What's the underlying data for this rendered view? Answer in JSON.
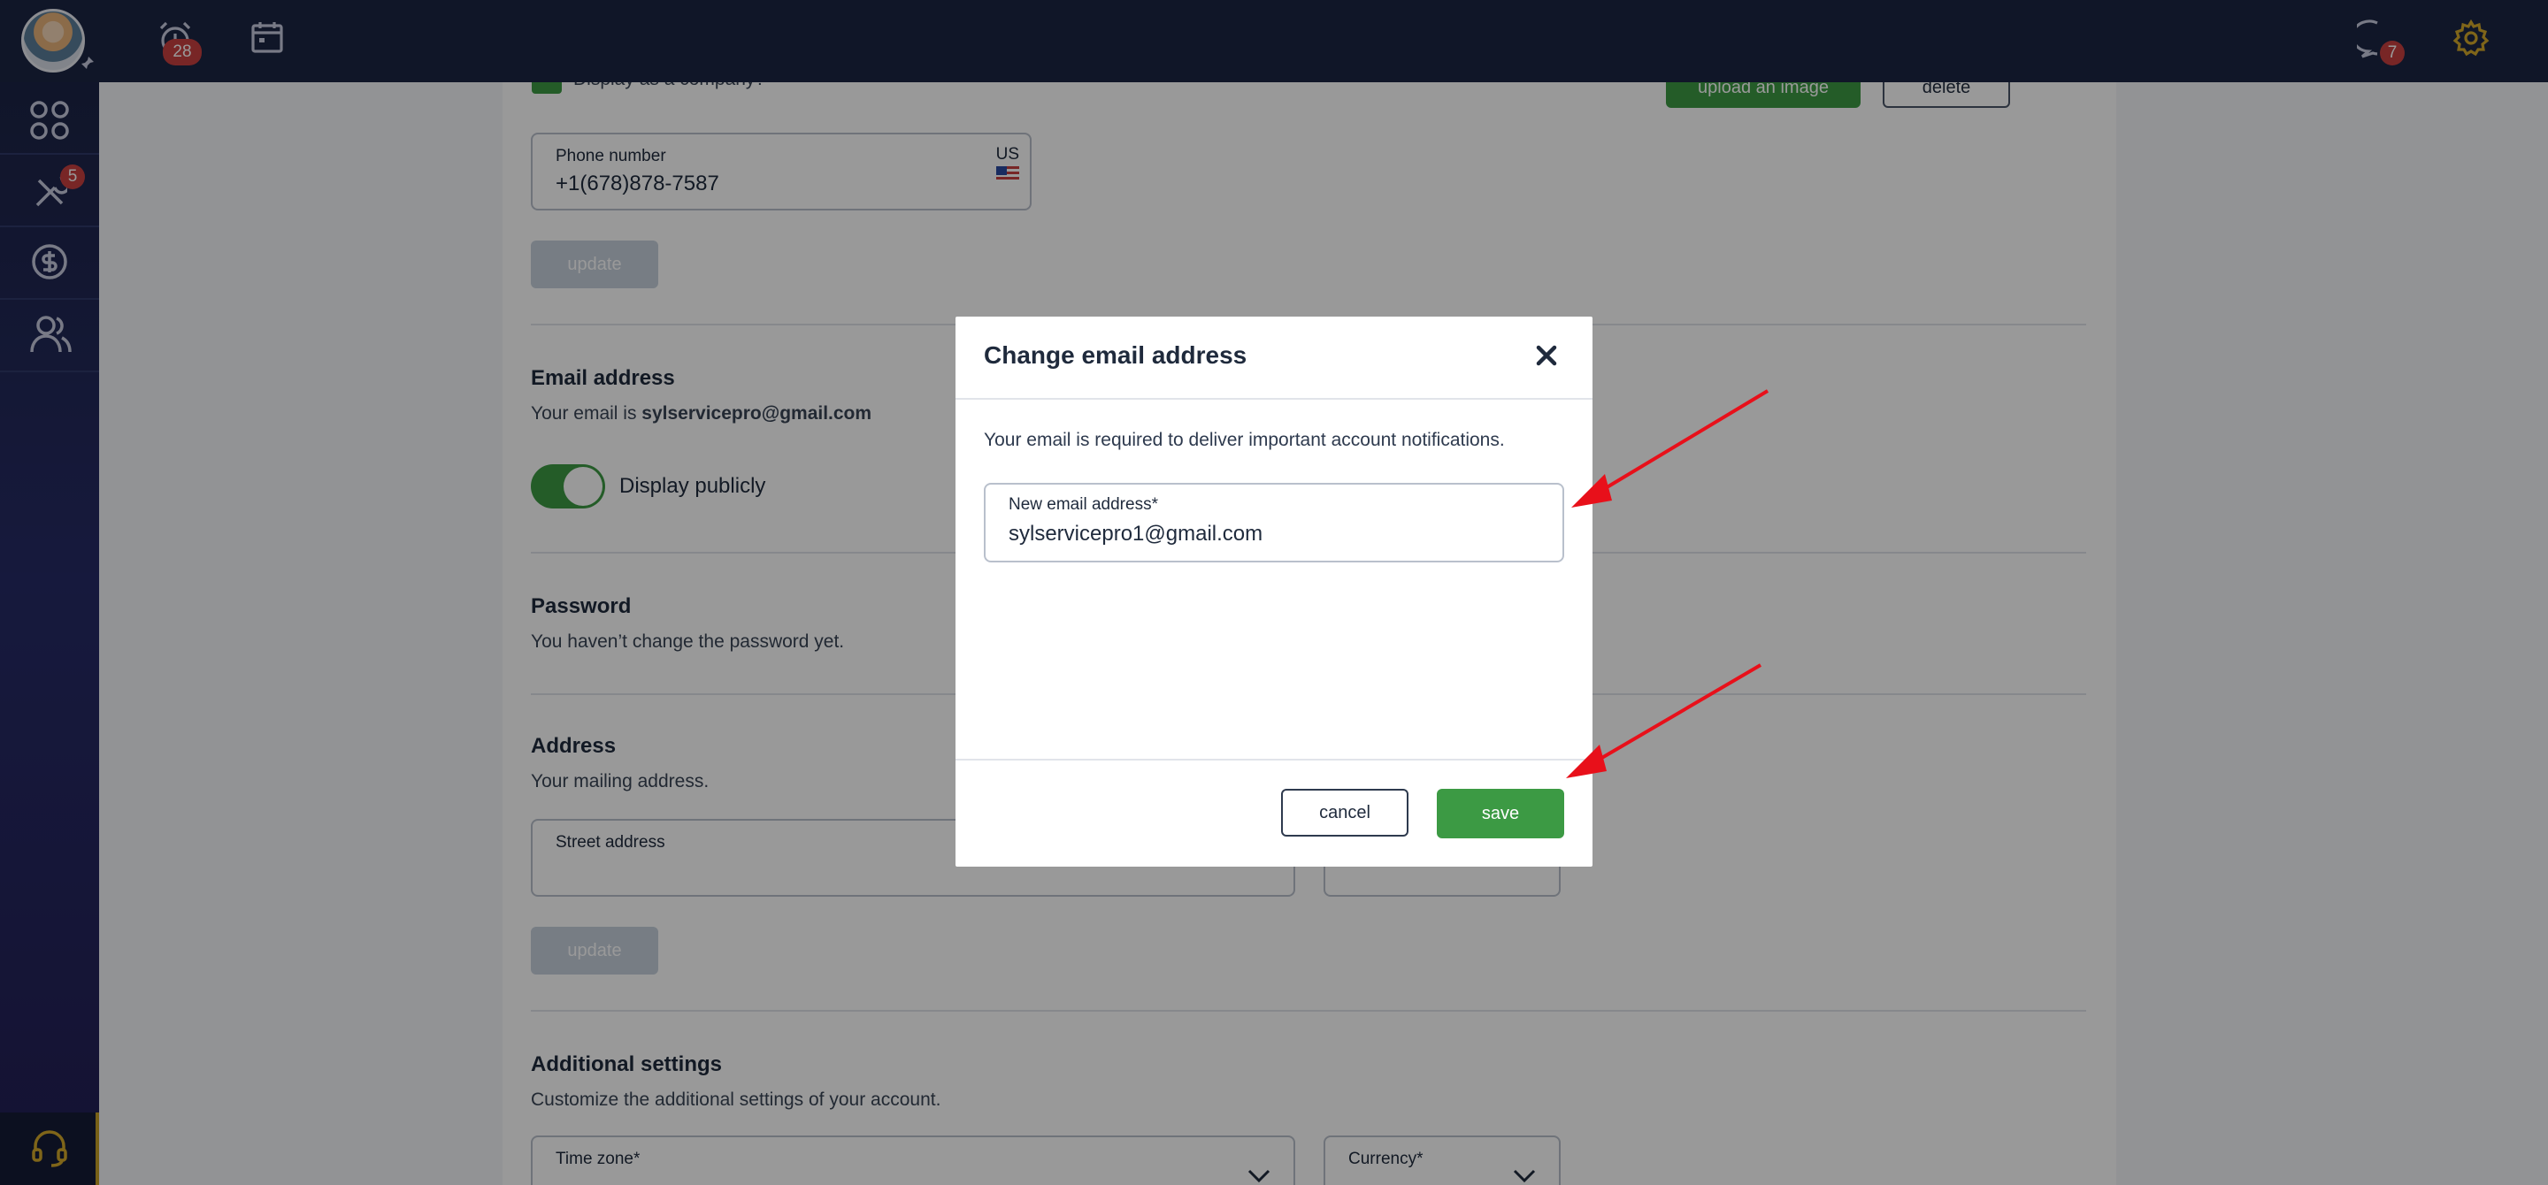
{
  "header": {
    "alarm_badge": "28",
    "messages_badge": "7"
  },
  "sidebar": {
    "tools_badge": "5"
  },
  "profile": {
    "display_company_label": "Display as a company?",
    "upload_image_label": "upload an image",
    "delete_label": "delete",
    "phone": {
      "label": "Phone number",
      "value": "+1(678)878-7587",
      "country": "US"
    },
    "update_label": "update",
    "email": {
      "title": "Email address",
      "text_prefix": "Your email is ",
      "current": "sylservicepro@gmail.com",
      "display_publicly_label": "Display publicly"
    },
    "password": {
      "title": "Password",
      "text": "You haven’t change the password yet."
    },
    "address": {
      "title": "Address",
      "text": "Your mailing address.",
      "street_label": "Street address"
    },
    "additional": {
      "title": "Additional settings",
      "text": "Customize the additional settings of your account.",
      "timezone_label": "Time zone*",
      "currency_label": "Currency*"
    }
  },
  "modal": {
    "title": "Change email address",
    "description": "Your email is required to deliver important account notifications.",
    "input_label": "New email address*",
    "input_value": "sylservicepro1@gmail.com",
    "cancel_label": "cancel",
    "save_label": "save"
  },
  "colors": {
    "topbar": "#1b2544",
    "accent_green": "#3c9a44",
    "badge_red": "#c94040",
    "annotation_arrow": "#e8101a"
  }
}
